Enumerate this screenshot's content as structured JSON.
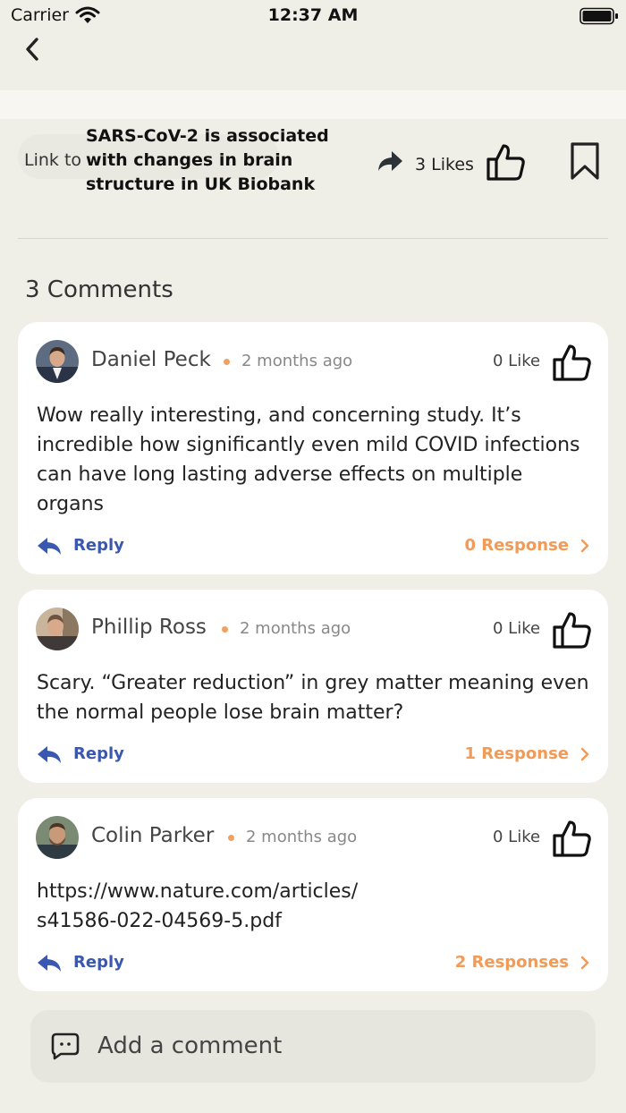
{
  "status_bar": {
    "carrier": "Carrier",
    "time": "12:37 AM"
  },
  "post": {
    "link_prefix": "Link to",
    "link_title": "SARS-CoV-2 is associated with changes in brain structure in UK Biobank",
    "likes": "3 Likes"
  },
  "comments_header": "3 Comments",
  "comments": [
    {
      "author": "Daniel Peck",
      "time": "2 months ago",
      "likes": "0 Like",
      "text": "Wow really interesting, and concerning study. It’s incredible how significantly even mild COVID infections can have long lasting adverse effects on multiple organs",
      "reply_label": "Reply",
      "responses": "0 Response"
    },
    {
      "author": "Phillip Ross",
      "time": "2 months ago",
      "likes": "0 Like",
      "text": "Scary. “Greater reduction” in grey matter meaning even the normal people lose brain matter?",
      "reply_label": "Reply",
      "responses": "1 Response"
    },
    {
      "author": "Colin Parker",
      "time": "2 months ago",
      "likes": "0 Like",
      "text": "https://www.nature.com/articles/\ns41586-022-04569-5.pdf",
      "reply_label": "Reply",
      "responses": "2 Responses"
    }
  ],
  "composer": {
    "placeholder": "Add a comment"
  },
  "colors": {
    "background": "#efeee7",
    "card": "#ffffff",
    "accent_blue": "#3a58b0",
    "accent_orange": "#f29a57"
  }
}
